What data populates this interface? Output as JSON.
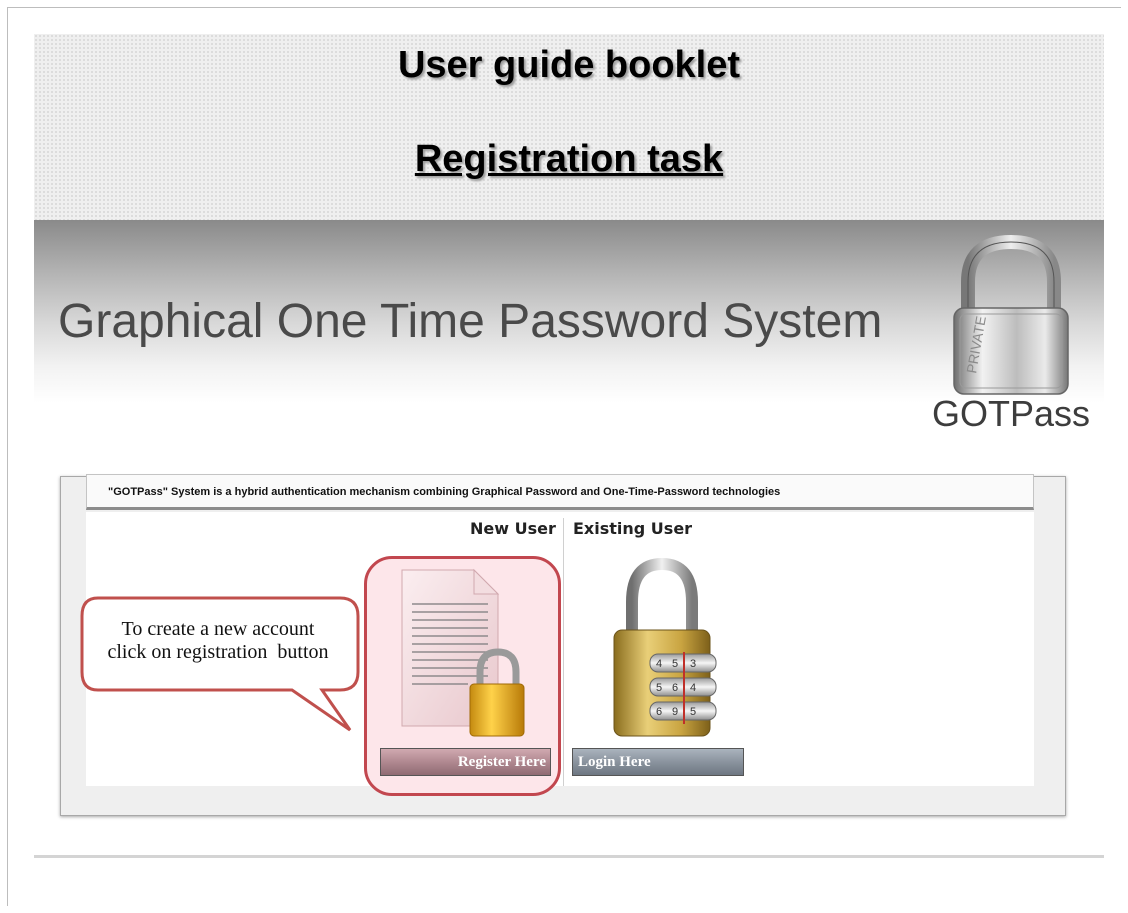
{
  "heading": {
    "title": "User guide booklet",
    "subtitle": "Registration task"
  },
  "banner": {
    "title": "Graphical One Time Password System",
    "brand": "GOTPass",
    "lock_label": "PRIVATE"
  },
  "app": {
    "description": "\"GOTPass\" System is a hybrid authentication mechanism combining Graphical Password and One-Time-Password technologies",
    "new_user_header": "New User",
    "existing_user_header": "Existing User",
    "register_button": "Register Here",
    "login_button": "Login Here",
    "safe_digits": [
      "4",
      "5",
      "3",
      "5",
      "6",
      "4",
      "6",
      "9",
      "5"
    ]
  },
  "callout": {
    "line1": "To create a new account",
    "line2": "click on registration  button"
  },
  "colors": {
    "highlight_border": "#c2474f",
    "highlight_fill": "#fde6ea",
    "callout_border": "#c0504d"
  },
  "icons": {
    "brand_lock": "padlock-icon",
    "register": "document-with-padlock-icon",
    "login": "combination-padlock-icon"
  }
}
